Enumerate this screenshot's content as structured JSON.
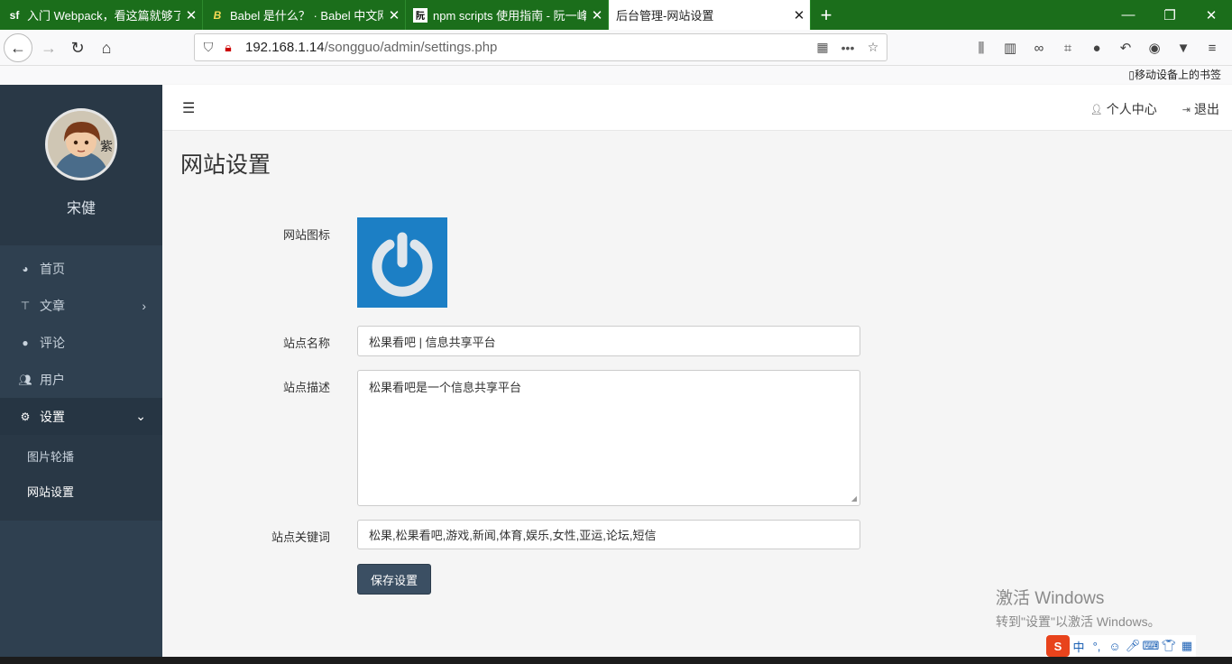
{
  "browser": {
    "tabs": [
      {
        "favicon": "sf",
        "title": "入门 Webpack，看这篇就够了"
      },
      {
        "favicon": "B",
        "title": "Babel 是什么？ · Babel 中文网"
      },
      {
        "favicon": "阮",
        "title": "npm scripts 使用指南 - 阮一峰"
      },
      {
        "favicon": "",
        "title": "后台管理-网站设置"
      }
    ],
    "url_host": "192.168.1.14",
    "url_path": "/songguo/admin/settings.php",
    "bookmark_mobile": "移动设备上的书签"
  },
  "sidebar": {
    "username": "宋健",
    "items": [
      {
        "label": "首页",
        "icon": "dashboard-icon"
      },
      {
        "label": "文章",
        "icon": "pin-icon"
      },
      {
        "label": "评论",
        "icon": "comment-icon"
      },
      {
        "label": "用户",
        "icon": "users-icon"
      },
      {
        "label": "设置",
        "icon": "gears-icon"
      }
    ],
    "subitems": [
      {
        "label": "图片轮播"
      },
      {
        "label": "网站设置"
      }
    ]
  },
  "topnav": {
    "profile_link": "个人中心",
    "logout_link": "退出"
  },
  "page": {
    "title": "网站设置"
  },
  "form": {
    "logo_label": "网站图标",
    "name_label": "站点名称",
    "name_value": "松果看吧 | 信息共享平台",
    "desc_label": "站点描述",
    "desc_value": "松果看吧是一个信息共享平台",
    "keywords_label": "站点关键词",
    "keywords_value": "松果,松果看吧,游戏,新闻,体育,娱乐,女性,亚运,论坛,短信",
    "save_label": "保存设置"
  },
  "os": {
    "watermark_line1": "激活 Windows",
    "watermark_line2": "转到\"设置\"以激活 Windows。",
    "ime_mode": "中"
  },
  "colors": {
    "tab_strip": "#1b6e1b",
    "sidebar_bg": "#2f4050",
    "logo_bg": "#1c7fc5",
    "save_button": "#3b4f63"
  }
}
